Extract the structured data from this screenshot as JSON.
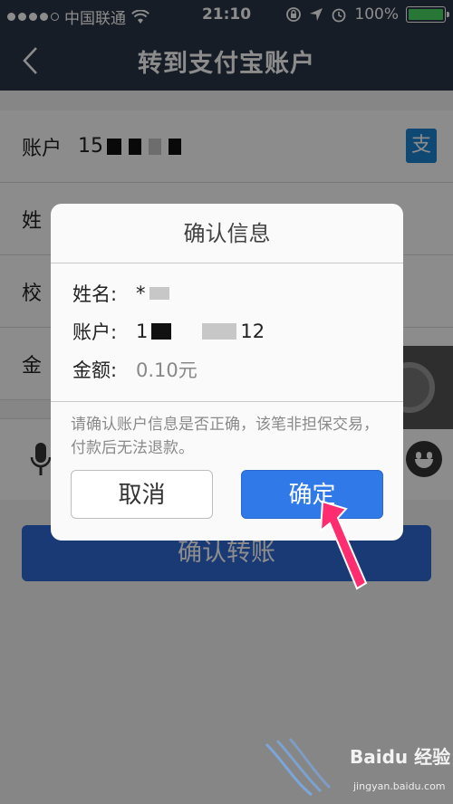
{
  "status": {
    "carrier": "中国联通",
    "time": "21:10",
    "battery": "100%"
  },
  "nav": {
    "title": "转到支付宝账户"
  },
  "form": {
    "account_label": "账户",
    "account_value": "15",
    "name_label": "姓",
    "verify_label": "校",
    "amount_label": "金",
    "alipay_glyph": "支"
  },
  "transfer_button": "确认转账",
  "dialog": {
    "title": "确认信息",
    "name_key": "姓名:",
    "name_val": "*",
    "account_key": "账户:",
    "account_prefix": "1",
    "account_suffix": "12",
    "amount_key": "金额:",
    "amount_val": "0.10元",
    "note": "请确认账户信息是否正确，该笔非担保交易，付款后无法退款。",
    "cancel": "取消",
    "confirm": "确定"
  },
  "watermark": {
    "brand": "Baidu 经验",
    "url": "jingyan.baidu.com"
  },
  "colors": {
    "nav_bg": "#2b3547",
    "primary_button": "#3079e8",
    "arrow": "#ff2d6f",
    "battery": "#4cd964"
  }
}
